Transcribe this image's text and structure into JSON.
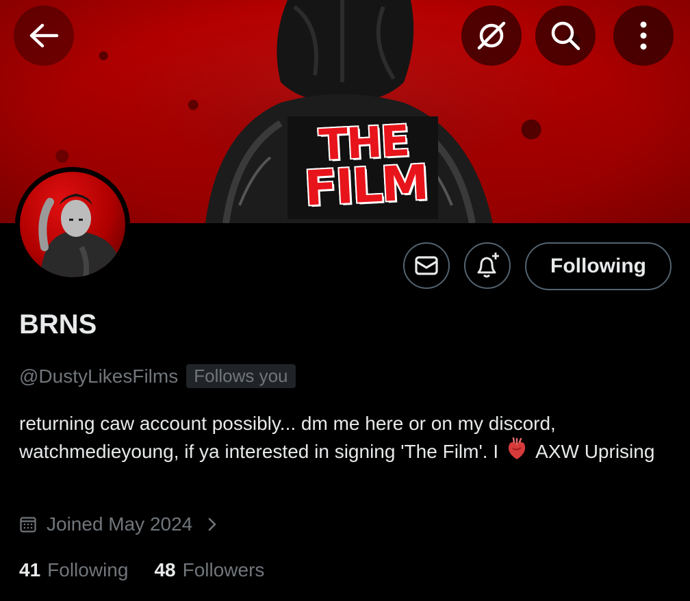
{
  "banner": {
    "logo_line1": "THE",
    "logo_line2": "FILM",
    "background_color": "#c20000"
  },
  "topbar": {
    "back_icon": "arrow-left-icon",
    "grok_icon": "slashed-circle-icon",
    "search_icon": "search-icon",
    "more_icon": "more-vertical-icon"
  },
  "profile": {
    "display_name": "BRNS",
    "handle": "@DustyLikesFilms",
    "follows_you": "Follows you",
    "bio_part1": "returning caw account possibly... dm me here or on my discord, watchmedieyoung, if ya interested in signing 'The Film'. I",
    "bio_emoji": "anatomical-heart",
    "bio_part2": "AXW Uprising",
    "joined": "Joined May 2024"
  },
  "actions": {
    "message_icon": "envelope-icon",
    "notify_icon": "bell-plus-icon",
    "following_label": "Following"
  },
  "stats": {
    "following_count": "41",
    "following_label": "Following",
    "followers_count": "48",
    "followers_label": "Followers"
  },
  "colors": {
    "background": "#000000",
    "text_primary": "#e7e9ea",
    "text_secondary": "#71767b",
    "border": "#536471",
    "banner_red": "#c20000"
  }
}
